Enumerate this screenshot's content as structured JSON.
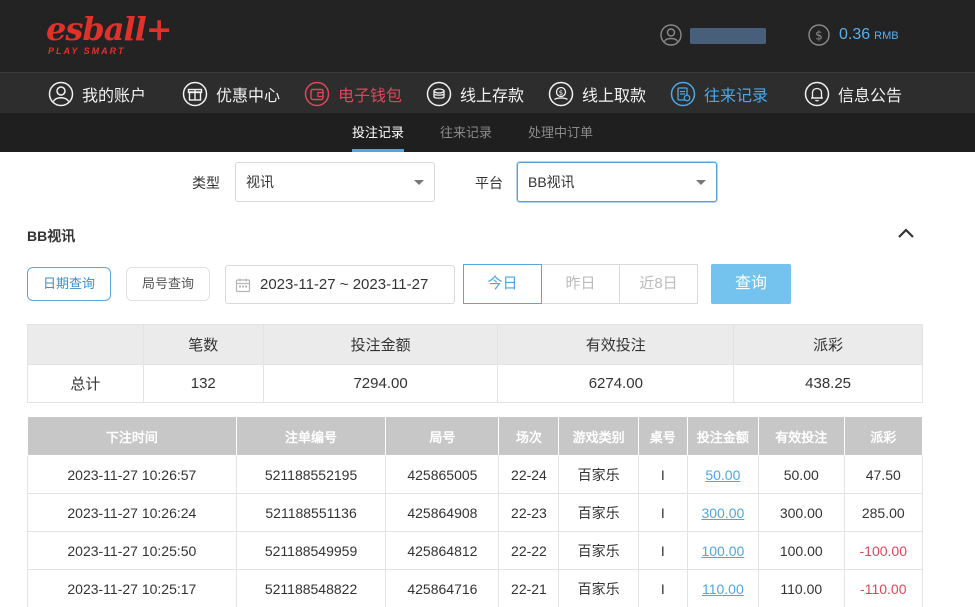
{
  "header": {
    "logo_text": "esball+",
    "logo_tagline": "PLAY SMART",
    "balance": "0.36",
    "currency": "RMB"
  },
  "nav": {
    "items": [
      {
        "label": "我的账户",
        "icon": "user-icon"
      },
      {
        "label": "优惠中心",
        "icon": "gift-icon"
      },
      {
        "label": "电子钱包",
        "icon": "wallet-icon"
      },
      {
        "label": "线上存款",
        "icon": "deposit-icon"
      },
      {
        "label": "线上取款",
        "icon": "withdraw-icon"
      },
      {
        "label": "往来记录",
        "icon": "records-icon"
      },
      {
        "label": "信息公告",
        "icon": "bell-icon"
      }
    ],
    "colors": {
      "active": "#4aa8e8",
      "wallet": "#e0465a"
    }
  },
  "subnav": {
    "items": [
      {
        "label": "投注记录"
      },
      {
        "label": "往来记录"
      },
      {
        "label": "处理中订单"
      }
    ]
  },
  "filters": {
    "type_label": "类型",
    "type_value": "视讯",
    "platform_label": "平台",
    "platform_value": "BB视讯"
  },
  "section": {
    "title": "BB视讯",
    "date_query": "日期查询",
    "round_query": "局号查询",
    "date_range": "2023-11-27 ~ 2023-11-27",
    "ranges": [
      "今日",
      "昨日",
      "近8日"
    ],
    "query_button": "查询"
  },
  "summary": {
    "headers": [
      "笔数",
      "投注金额",
      "有效投注",
      "派彩"
    ],
    "row_label": "总计",
    "values": [
      "132",
      "7294.00",
      "6274.00",
      "438.25"
    ]
  },
  "records": {
    "headers": [
      "下注时间",
      "注单编号",
      "局号",
      "场次",
      "游戏类别",
      "桌号",
      "投注金额",
      "有效投注",
      "派彩"
    ],
    "rows": [
      {
        "time": "2023-11-27 10:26:57",
        "order": "521188552195",
        "round": "425865005",
        "session": "22-24",
        "game": "百家乐",
        "table": "I",
        "bet": "50.00",
        "valid": "50.00",
        "payout": "47.50"
      },
      {
        "time": "2023-11-27 10:26:24",
        "order": "521188551136",
        "round": "425864908",
        "session": "22-23",
        "game": "百家乐",
        "table": "I",
        "bet": "300.00",
        "valid": "300.00",
        "payout": "285.00"
      },
      {
        "time": "2023-11-27 10:25:50",
        "order": "521188549959",
        "round": "425864812",
        "session": "22-22",
        "game": "百家乐",
        "table": "I",
        "bet": "100.00",
        "valid": "100.00",
        "payout": "-100.00"
      },
      {
        "time": "2023-11-27 10:25:17",
        "order": "521188548822",
        "round": "425864716",
        "session": "22-21",
        "game": "百家乐",
        "table": "I",
        "bet": "110.00",
        "valid": "110.00",
        "payout": "-110.00"
      }
    ]
  }
}
